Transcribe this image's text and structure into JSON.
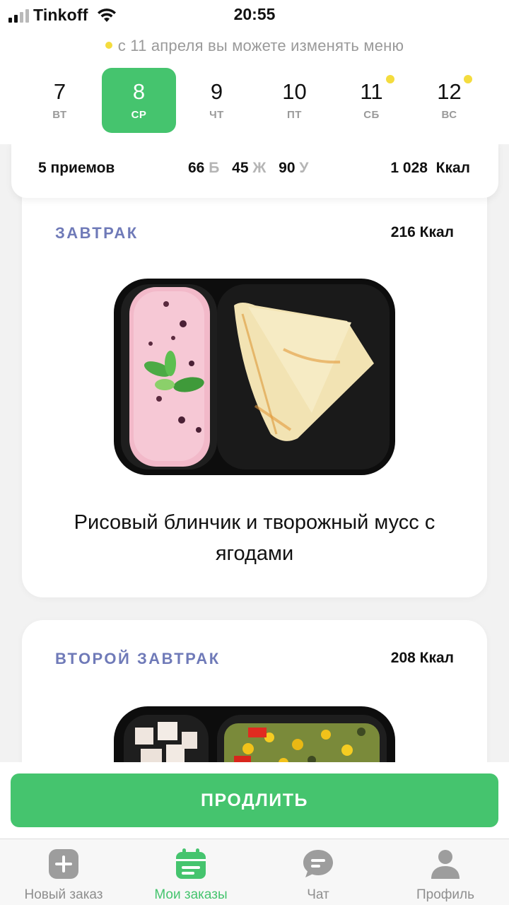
{
  "status_bar": {
    "carrier": "Tinkoff",
    "time": "20:55"
  },
  "notice": "с 11 апреля вы можете изменять меню",
  "days": [
    {
      "num": "7",
      "name": "ВТ",
      "active": false,
      "marked": false
    },
    {
      "num": "8",
      "name": "СР",
      "active": true,
      "marked": false
    },
    {
      "num": "9",
      "name": "ЧТ",
      "active": false,
      "marked": false
    },
    {
      "num": "10",
      "name": "ПТ",
      "active": false,
      "marked": false
    },
    {
      "num": "11",
      "name": "СБ",
      "active": false,
      "marked": true
    },
    {
      "num": "12",
      "name": "ВС",
      "active": false,
      "marked": true
    }
  ],
  "summary": {
    "meals": "5 приемов",
    "protein_value": "66",
    "protein_label": "Б",
    "fat_value": "45",
    "fat_label": "Ж",
    "carb_value": "90",
    "carb_label": "У",
    "kcal": "1 028  Ккал"
  },
  "meals": [
    {
      "title": "ЗАВТРАК",
      "kcal": "216 Ккал",
      "description": "Рисовый блинчик и творожный мусс с ягодами"
    },
    {
      "title": "ВТОРОЙ ЗАВТРАК",
      "kcal": "208 Ккал"
    }
  ],
  "prolong_label": "ПРОДЛИТЬ",
  "tabs": [
    {
      "label": "Новый заказ",
      "icon": "plus-square-icon",
      "active": false
    },
    {
      "label": "Мои заказы",
      "icon": "calendar-icon",
      "active": true
    },
    {
      "label": "Чат",
      "icon": "chat-bubble-icon",
      "active": false
    },
    {
      "label": "Профиль",
      "icon": "profile-icon",
      "active": false
    }
  ],
  "colors": {
    "accent": "#45c46e",
    "meal_title": "#6f7ab8",
    "marker": "#f4dc3e",
    "muted": "#9a9a9a"
  }
}
